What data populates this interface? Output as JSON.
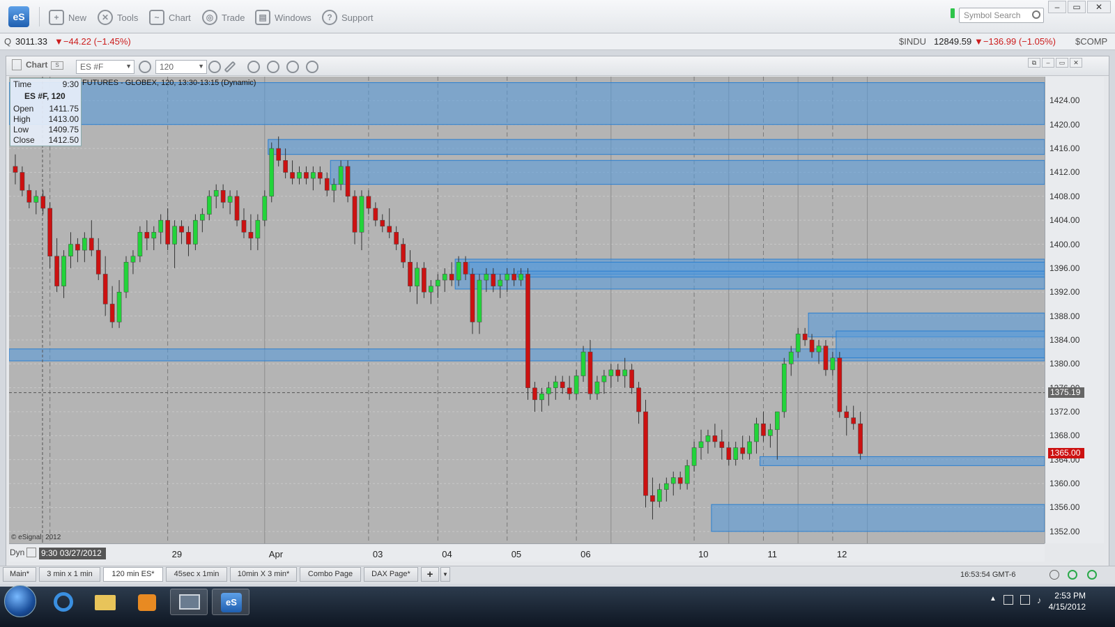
{
  "toolbar": {
    "logo": "eS",
    "buttons": [
      "New",
      "Tools",
      "Chart",
      "Trade",
      "Windows",
      "Support"
    ],
    "search_placeholder": "Symbol Search",
    "window_controls": [
      "–",
      "▭",
      "✕"
    ]
  },
  "ticker": {
    "left_prefix": "Q",
    "left_value": "3011.33",
    "left_change": "▼−44.22 (−1.45%)",
    "indu_symbol": "$INDU",
    "indu_value": "12849.59",
    "indu_change": "▼−136.99 (−1.05%)",
    "comp_symbol": "$COMP"
  },
  "chart_header": {
    "title": "Chart",
    "symbol": "ES #F",
    "interval": "120"
  },
  "info_box": {
    "time_label": "Time",
    "time_value": "9:30",
    "symbol_line": "ES #F, 120",
    "open_label": "Open",
    "open_value": "1411.75",
    "high_label": "High",
    "high_value": "1413.00",
    "low_label": "Low",
    "low_value": "1409.75",
    "close_label": "Close",
    "close_value": "1412.50"
  },
  "study_title": "FUTURES - GLOBEX, 120, 13:30-13:15 (Dynamic)",
  "copyright": "© eSignal, 2012",
  "dyn_label": "Dyn",
  "cursor_time": "9:30 03/27/2012",
  "colors": {
    "up": "#22d43a",
    "down": "#cc1111",
    "zone_fill": "#5a9bd8",
    "zone_stroke": "#2a7fd0",
    "plot_bg": "#b4b4b4",
    "last_price_badge": "#cc1111",
    "crosshair_badge": "#666666"
  },
  "chart_data": {
    "type": "candlestick",
    "title": "",
    "ylim": [
      1350,
      1428
    ],
    "y_ticks": [
      1352,
      1356,
      1360,
      1364,
      1368,
      1372,
      1376,
      1380,
      1384,
      1388,
      1392,
      1396,
      1400,
      1404,
      1408,
      1412,
      1416,
      1420,
      1424
    ],
    "y_tick_labels": [
      "1352.00",
      "1356.00",
      "1360.00",
      "1364.00",
      "1368.00",
      "1372.00",
      "1376.00",
      "1380.00",
      "1384.00",
      "1388.00",
      "1392.00",
      "1396.00",
      "1400.00",
      "1404.00",
      "1408.00",
      "1412.00",
      "1416.00",
      "1420.00",
      "1424.00"
    ],
    "x_labels": [
      "29",
      "Apr",
      "03",
      "04",
      "05",
      "06",
      "10",
      "11",
      "12"
    ],
    "x_label_bars": [
      22,
      36,
      51,
      61,
      71,
      81,
      98,
      108,
      118
    ],
    "crosshair_price": "1375.19",
    "last_price": "1365.00",
    "crosshair_value": 1375.19,
    "last_value": 1365.0,
    "bar_count": 133,
    "candles": [
      [
        1413,
        1415,
        1410,
        1412
      ],
      [
        1412,
        1413,
        1408,
        1409
      ],
      [
        1409,
        1410,
        1406,
        1407
      ],
      [
        1407,
        1409,
        1405,
        1408
      ],
      [
        1408,
        1409,
        1405,
        1406
      ],
      [
        1406,
        1407,
        1396,
        1398
      ],
      [
        1398,
        1401,
        1392,
        1393
      ],
      [
        1393,
        1399,
        1391,
        1398
      ],
      [
        1398,
        1402,
        1396,
        1400
      ],
      [
        1400,
        1401,
        1397,
        1399
      ],
      [
        1399,
        1402,
        1397,
        1401
      ],
      [
        1401,
        1404,
        1398,
        1399
      ],
      [
        1399,
        1401,
        1394,
        1395
      ],
      [
        1395,
        1398,
        1388,
        1390
      ],
      [
        1390,
        1393,
        1386,
        1387
      ],
      [
        1387,
        1394,
        1386,
        1392
      ],
      [
        1392,
        1398,
        1391,
        1397
      ],
      [
        1397,
        1399,
        1395,
        1398
      ],
      [
        1398,
        1403,
        1397,
        1402
      ],
      [
        1402,
        1404,
        1399,
        1401
      ],
      [
        1401,
        1403,
        1399,
        1402
      ],
      [
        1402,
        1405,
        1400,
        1404
      ],
      [
        1404,
        1406,
        1399,
        1400
      ],
      [
        1400,
        1404,
        1396,
        1403
      ],
      [
        1403,
        1404,
        1400,
        1402
      ],
      [
        1402,
        1403,
        1398,
        1400
      ],
      [
        1400,
        1405,
        1399,
        1404
      ],
      [
        1404,
        1406,
        1402,
        1405
      ],
      [
        1405,
        1409,
        1404,
        1408
      ],
      [
        1408,
        1410,
        1406,
        1409
      ],
      [
        1409,
        1410,
        1406,
        1407
      ],
      [
        1407,
        1409,
        1405,
        1408
      ],
      [
        1408,
        1409,
        1403,
        1404
      ],
      [
        1404,
        1406,
        1401,
        1402
      ],
      [
        1402,
        1405,
        1399,
        1401
      ],
      [
        1401,
        1405,
        1399,
        1404
      ],
      [
        1404,
        1409,
        1403,
        1408
      ],
      [
        1408,
        1417,
        1407,
        1416
      ],
      [
        1416,
        1418,
        1413,
        1414
      ],
      [
        1414,
        1416,
        1411,
        1412
      ],
      [
        1412,
        1414,
        1410,
        1411
      ],
      [
        1411,
        1413,
        1410,
        1412
      ],
      [
        1412,
        1413,
        1410,
        1411
      ],
      [
        1411,
        1413,
        1409,
        1412
      ],
      [
        1412,
        1413,
        1410,
        1411
      ],
      [
        1411,
        1412,
        1408,
        1409
      ],
      [
        1409,
        1411,
        1407,
        1410
      ],
      [
        1410,
        1414,
        1409,
        1413
      ],
      [
        1413,
        1414,
        1407,
        1408
      ],
      [
        1408,
        1409,
        1400,
        1402
      ],
      [
        1402,
        1409,
        1399,
        1408
      ],
      [
        1408,
        1409,
        1405,
        1406
      ],
      [
        1406,
        1407,
        1403,
        1404
      ],
      [
        1404,
        1405,
        1402,
        1403
      ],
      [
        1403,
        1406,
        1401,
        1402
      ],
      [
        1402,
        1403,
        1399,
        1400
      ],
      [
        1400,
        1401,
        1396,
        1397
      ],
      [
        1397,
        1399,
        1392,
        1393
      ],
      [
        1393,
        1397,
        1390,
        1396
      ],
      [
        1396,
        1397,
        1391,
        1392
      ],
      [
        1392,
        1394,
        1390,
        1393
      ],
      [
        1393,
        1395,
        1391,
        1394
      ],
      [
        1394,
        1396,
        1392,
        1395
      ],
      [
        1395,
        1397,
        1393,
        1394
      ],
      [
        1394,
        1398,
        1393,
        1397
      ],
      [
        1397,
        1398,
        1394,
        1395
      ],
      [
        1395,
        1396,
        1385,
        1387
      ],
      [
        1387,
        1395,
        1385,
        1394
      ],
      [
        1394,
        1396,
        1392,
        1395
      ],
      [
        1395,
        1396,
        1392,
        1393
      ],
      [
        1393,
        1395,
        1391,
        1394
      ],
      [
        1394,
        1396,
        1392,
        1395
      ],
      [
        1395,
        1396,
        1393,
        1394
      ],
      [
        1394,
        1396,
        1393,
        1395
      ],
      [
        1395,
        1396,
        1374,
        1376
      ],
      [
        1376,
        1377,
        1372,
        1374
      ],
      [
        1374,
        1376,
        1372,
        1375
      ],
      [
        1375,
        1377,
        1373,
        1376
      ],
      [
        1376,
        1378,
        1374,
        1377
      ],
      [
        1377,
        1378,
        1375,
        1376
      ],
      [
        1376,
        1378,
        1374,
        1375
      ],
      [
        1375,
        1379,
        1374,
        1378
      ],
      [
        1378,
        1383,
        1377,
        1382
      ],
      [
        1382,
        1384,
        1374,
        1375
      ],
      [
        1375,
        1378,
        1374,
        1377
      ],
      [
        1377,
        1379,
        1375,
        1378
      ],
      [
        1378,
        1380,
        1376,
        1379
      ],
      [
        1379,
        1380,
        1377,
        1378
      ],
      [
        1378,
        1381,
        1376,
        1379
      ],
      [
        1379,
        1380,
        1375,
        1376
      ],
      [
        1376,
        1377,
        1370,
        1372
      ],
      [
        1372,
        1374,
        1356,
        1358
      ],
      [
        1358,
        1361,
        1354,
        1357
      ],
      [
        1357,
        1360,
        1356,
        1359
      ],
      [
        1359,
        1361,
        1357,
        1360
      ],
      [
        1360,
        1362,
        1358,
        1361
      ],
      [
        1361,
        1362,
        1359,
        1360
      ],
      [
        1360,
        1364,
        1359,
        1363
      ],
      [
        1363,
        1367,
        1362,
        1366
      ],
      [
        1366,
        1369,
        1364,
        1367
      ],
      [
        1367,
        1369,
        1365,
        1368
      ],
      [
        1368,
        1370,
        1366,
        1367
      ],
      [
        1367,
        1369,
        1364,
        1366
      ],
      [
        1366,
        1367,
        1363,
        1364
      ],
      [
        1364,
        1367,
        1363,
        1366
      ],
      [
        1366,
        1368,
        1364,
        1365
      ],
      [
        1365,
        1368,
        1364,
        1367
      ],
      [
        1367,
        1371,
        1365,
        1370
      ],
      [
        1370,
        1372,
        1367,
        1368
      ],
      [
        1368,
        1370,
        1366,
        1369
      ],
      [
        1369,
        1371,
        1364,
        1372
      ],
      [
        1372,
        1381,
        1371,
        1380
      ],
      [
        1380,
        1383,
        1378,
        1382
      ],
      [
        1382,
        1386,
        1381,
        1385
      ],
      [
        1385,
        1386,
        1383,
        1384
      ],
      [
        1384,
        1385,
        1381,
        1382
      ],
      [
        1382,
        1384,
        1380,
        1383
      ],
      [
        1383,
        1384,
        1378,
        1379
      ],
      [
        1379,
        1382,
        1378,
        1381
      ],
      [
        1381,
        1382,
        1371,
        1372
      ],
      [
        1372,
        1373,
        1368,
        1371
      ],
      [
        1371,
        1373,
        1369,
        1370
      ],
      [
        1370,
        1372,
        1364,
        1365
      ]
    ],
    "zones": [
      {
        "from_bar": 0,
        "top": 1427,
        "bottom": 1420
      },
      {
        "from_bar": 37,
        "top": 1417.5,
        "bottom": 1415
      },
      {
        "from_bar": 46,
        "top": 1414,
        "bottom": 1410
      },
      {
        "from_bar": 64,
        "top": 1397.5,
        "bottom": 1392.5
      },
      {
        "from_bar": 66,
        "top": 1397,
        "bottom": 1395
      },
      {
        "from_bar": 73,
        "top": 1395.5,
        "bottom": 1394.5
      },
      {
        "from_bar": 0,
        "top": 1382.5,
        "bottom": 1380.5
      },
      {
        "from_bar": 115,
        "top": 1388.5,
        "bottom": 1384.5
      },
      {
        "from_bar": 119,
        "top": 1385.5,
        "bottom": 1381
      },
      {
        "from_bar": 108,
        "top": 1364.5,
        "bottom": 1363
      },
      {
        "from_bar": 101,
        "top": 1356.5,
        "bottom": 1352
      }
    ],
    "vlines_dashed": [
      5,
      22,
      51,
      61,
      71,
      81,
      98,
      108,
      118
    ],
    "vlines_solid": [
      36,
      86,
      103,
      113,
      123
    ]
  },
  "tabs": [
    "Main*",
    "3 min x 1 min",
    "120 min ES*",
    "45sec x 1min",
    "10min X 3 min*",
    "Combo Page",
    "DAX Page*",
    "+"
  ],
  "active_tab": 2,
  "status_clock": "16:53:54 GMT-6",
  "taskbar": {
    "time": "2:53 PM",
    "date": "4/15/2012",
    "apps": [
      "ie-icon",
      "folder-icon",
      "media-player-icon",
      "remote-icon",
      "esignal-icon"
    ]
  }
}
